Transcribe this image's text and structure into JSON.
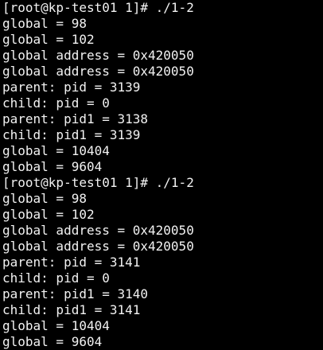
{
  "terminal": {
    "colors": {
      "background": "#000000",
      "foreground": "#f2f2f2"
    },
    "lines": [
      "[root@kp-test01 1]# ./1-2",
      "global = 98",
      "global = 102",
      "global address = 0x420050",
      "global address = 0x420050",
      "parent: pid = 3139",
      "child: pid = 0",
      "parent: pid1 = 3138",
      "child: pid1 = 3139",
      "global = 10404",
      "global = 9604",
      "[root@kp-test01 1]# ./1-2",
      "global = 98",
      "global = 102",
      "global address = 0x420050",
      "global address = 0x420050",
      "parent: pid = 3141",
      "child: pid = 0",
      "parent: pid1 = 3140",
      "child: pid1 = 3141",
      "global = 10404",
      "global = 9604"
    ]
  }
}
